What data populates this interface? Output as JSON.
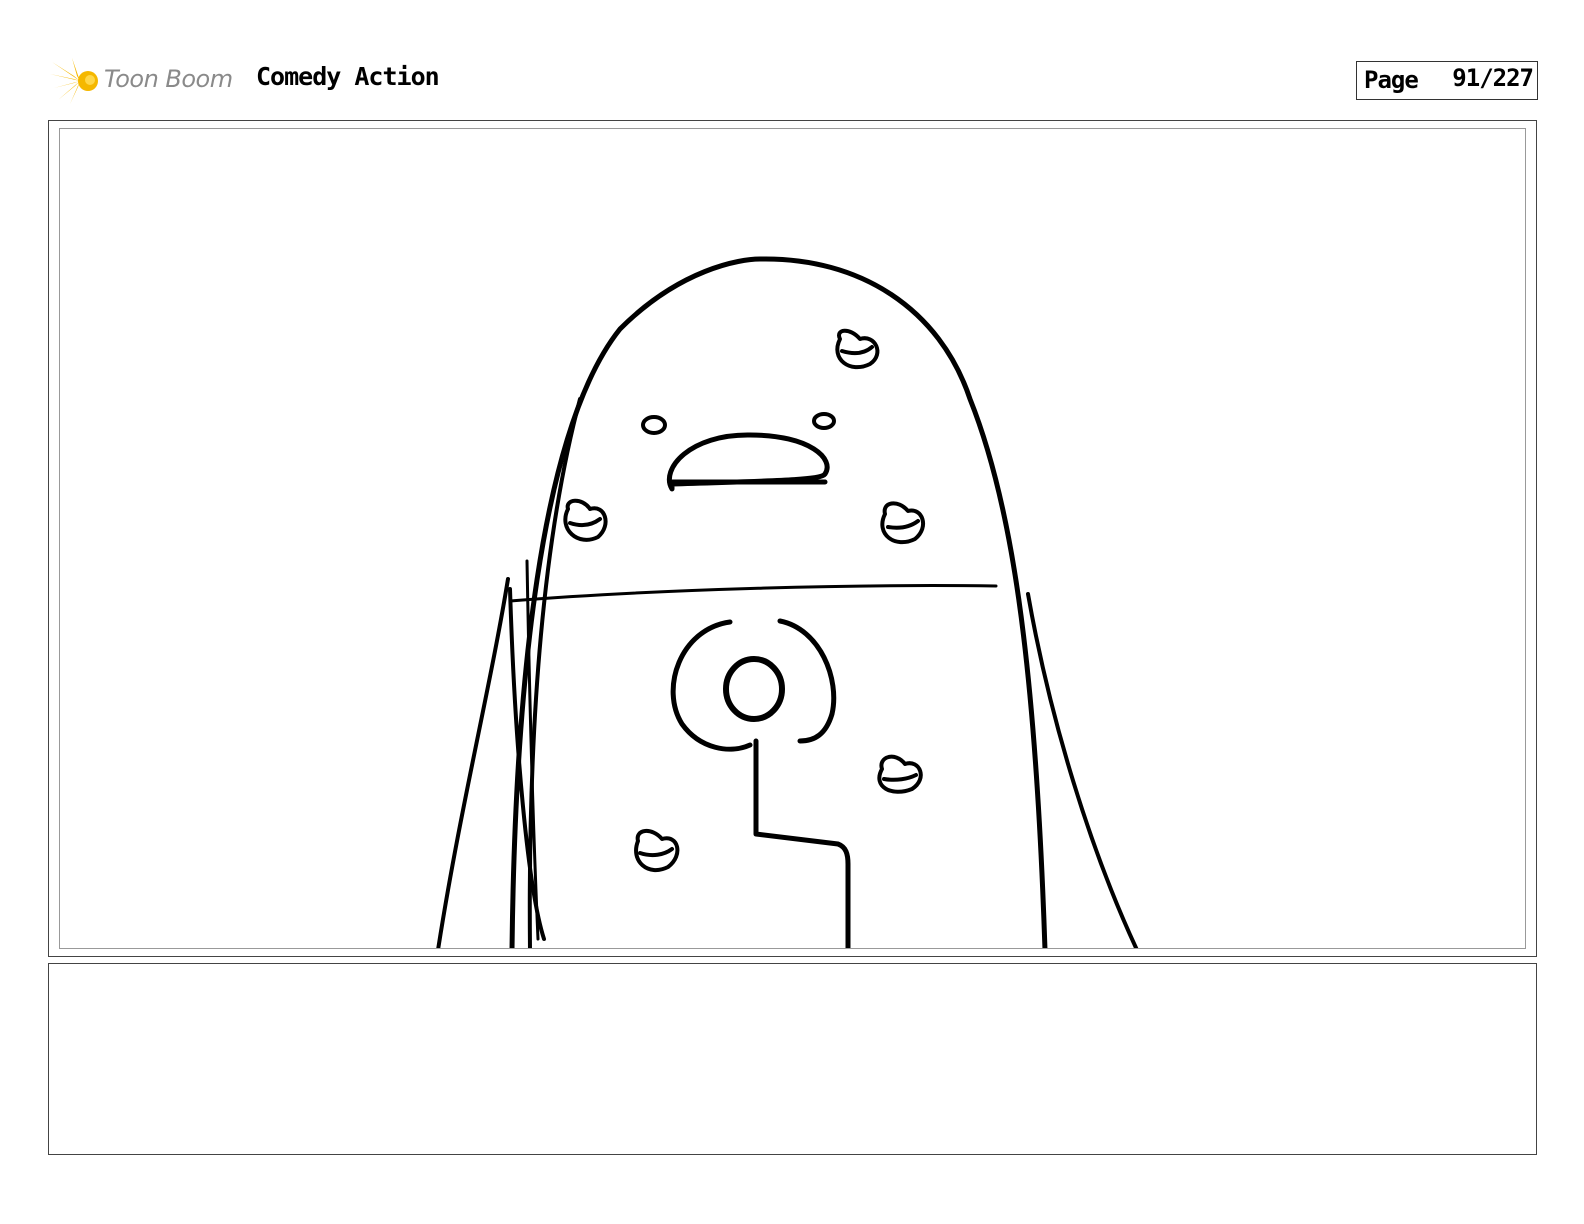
{
  "header": {
    "logo_text": "Toon Boom",
    "project_title": "Comedy Action",
    "page_label": "Page",
    "page_number": "91/227"
  },
  "logo_colors": {
    "flare_primary": "#f5b800",
    "flare_secondary": "#ffd84a",
    "text_color": "#8a8a8a"
  },
  "panel": {
    "drawing": "sketch-character-with-spots",
    "stroke_color": "#000000"
  },
  "notes": {
    "text": ""
  }
}
